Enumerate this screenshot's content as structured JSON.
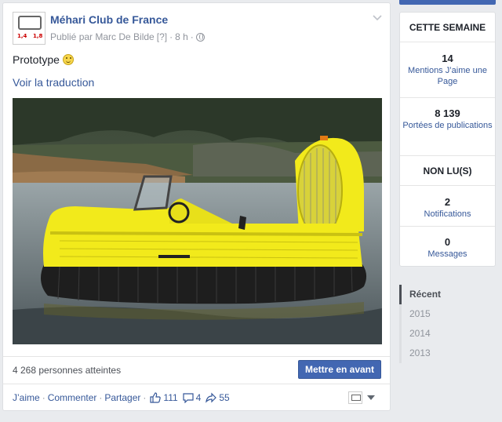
{
  "post": {
    "page_name": "Méhari Club de France",
    "published_by": "Publié par Marc De Bilde",
    "help_link": "[?]",
    "time": "8 h",
    "text": "Prototype",
    "translate_link": "Voir la traduction",
    "avatar": {
      "num_left": "1,4",
      "num_right": "1,8"
    },
    "photo_alt": "Yellow hovercraft prototype",
    "reach": "4 268 personnes atteintes",
    "boost_label": "Mettre en avant",
    "actions": {
      "like": "J’aime",
      "comment": "Commenter",
      "share": "Partager"
    },
    "counts": {
      "likes": "111",
      "comments": "4",
      "shares": "55"
    }
  },
  "sidebar": {
    "this_week_heading": "CETTE SEMAINE",
    "stats": [
      {
        "value": "14",
        "label": "Mentions J’aime une Page"
      },
      {
        "value": "8 139",
        "label": "Portées de publications"
      }
    ],
    "unread_heading": "NON LU(S)",
    "unread": [
      {
        "value": "2",
        "label": "Notifications"
      },
      {
        "value": "0",
        "label": "Messages"
      }
    ],
    "timeline": [
      {
        "label": "Récent"
      },
      {
        "label": "2015"
      },
      {
        "label": "2014"
      },
      {
        "label": "2013"
      }
    ]
  },
  "colors": {
    "link": "#365899",
    "button": "#4267b2",
    "hull": "#f2ea1b"
  }
}
